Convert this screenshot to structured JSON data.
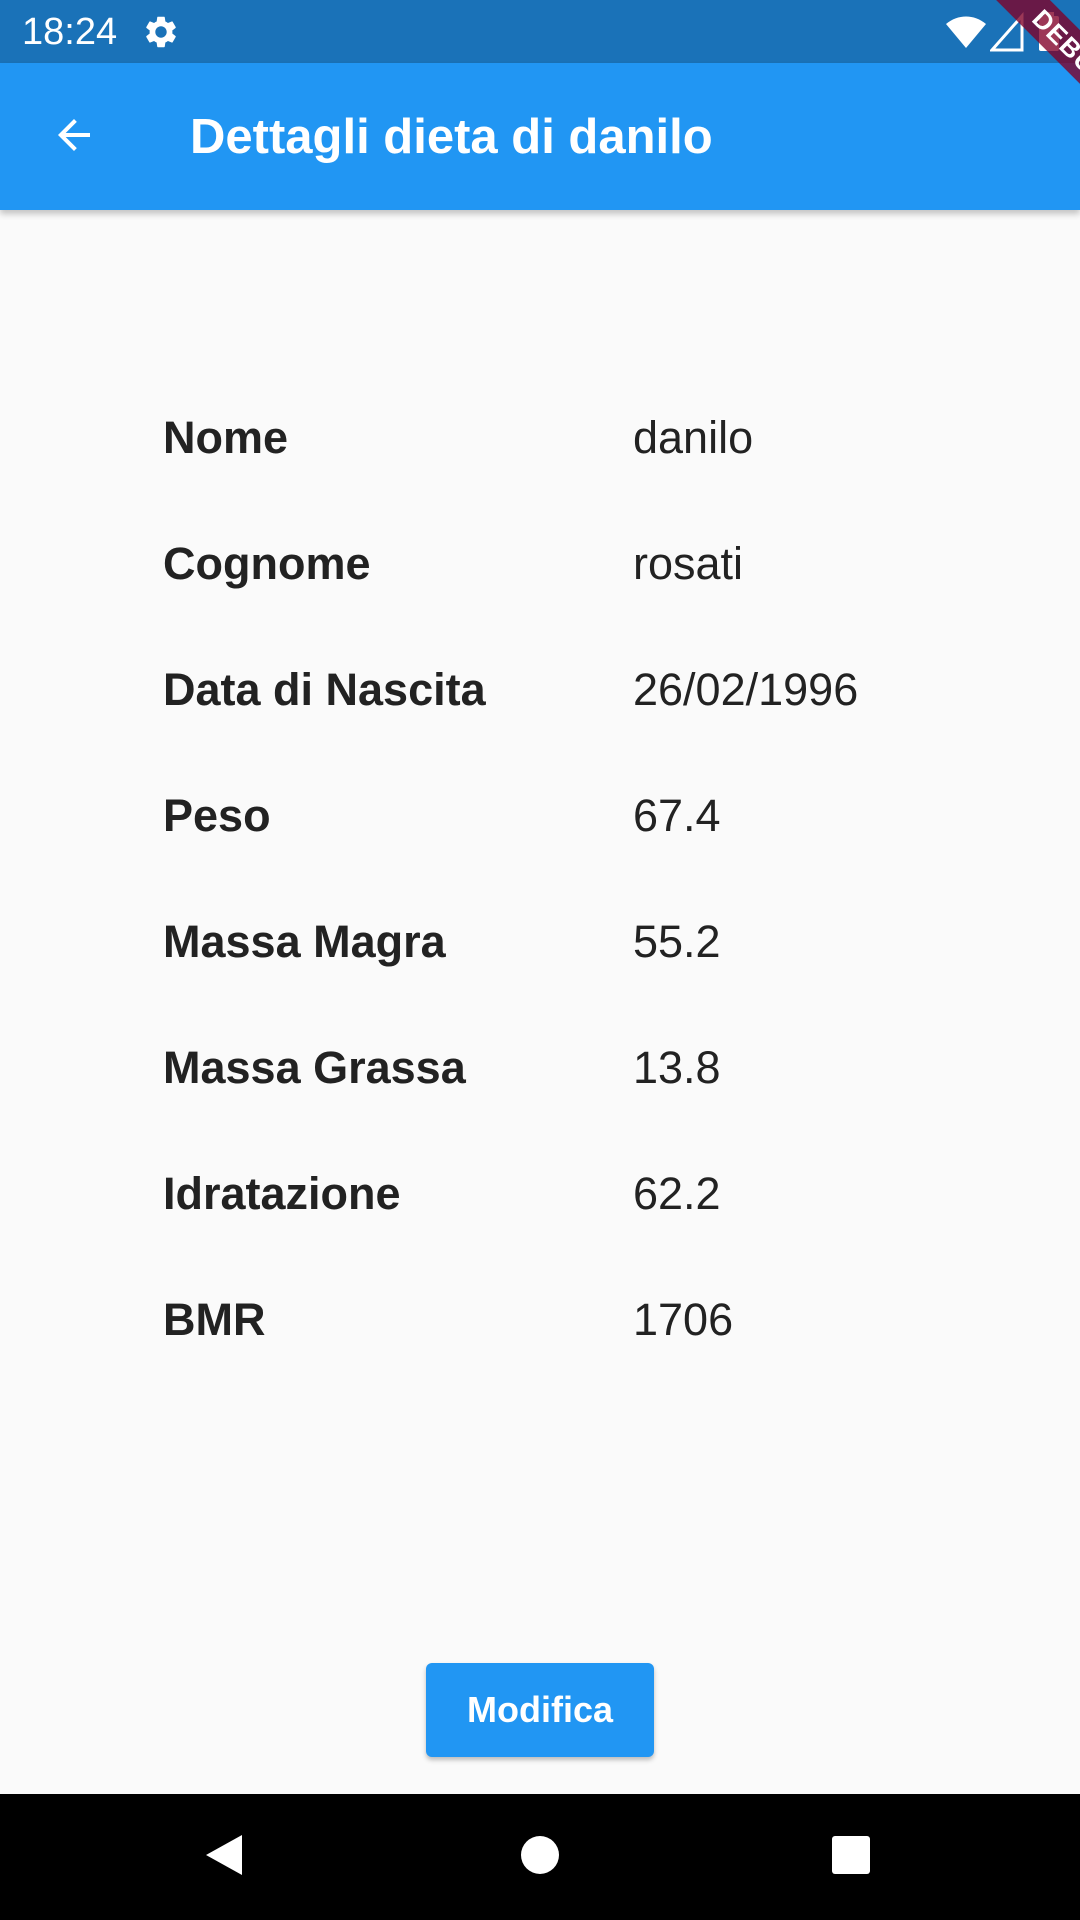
{
  "status_bar": {
    "time": "18:24",
    "icons": [
      "settings-gear-icon",
      "wifi-icon",
      "signal-icon",
      "battery-icon"
    ]
  },
  "app_bar": {
    "back_icon": "arrow-back-icon",
    "title": "Dettagli dieta di danilo"
  },
  "debug_banner": {
    "label": "DEBUG"
  },
  "details": {
    "rows": [
      {
        "label": "Nome",
        "value": "danilo"
      },
      {
        "label": "Cognome",
        "value": "rosati"
      },
      {
        "label": "Data di Nascita",
        "value": "26/02/1996"
      },
      {
        "label": "Peso",
        "value": "67.4"
      },
      {
        "label": "Massa Magra",
        "value": "55.2"
      },
      {
        "label": "Massa Grassa",
        "value": "13.8"
      },
      {
        "label": "Idratazione",
        "value": "62.2"
      },
      {
        "label": "BMR",
        "value": "1706"
      }
    ]
  },
  "actions": {
    "modify_label": "Modifica"
  },
  "nav_bar": {
    "icons": [
      "nav-back-icon",
      "nav-home-icon",
      "nav-recents-icon"
    ]
  },
  "colors": {
    "status_bar": "#1a72b8",
    "app_bar": "#2196f3",
    "background": "#fafafa",
    "text": "#222222",
    "debug_ribbon": "#800028",
    "nav_bar": "#000000"
  }
}
